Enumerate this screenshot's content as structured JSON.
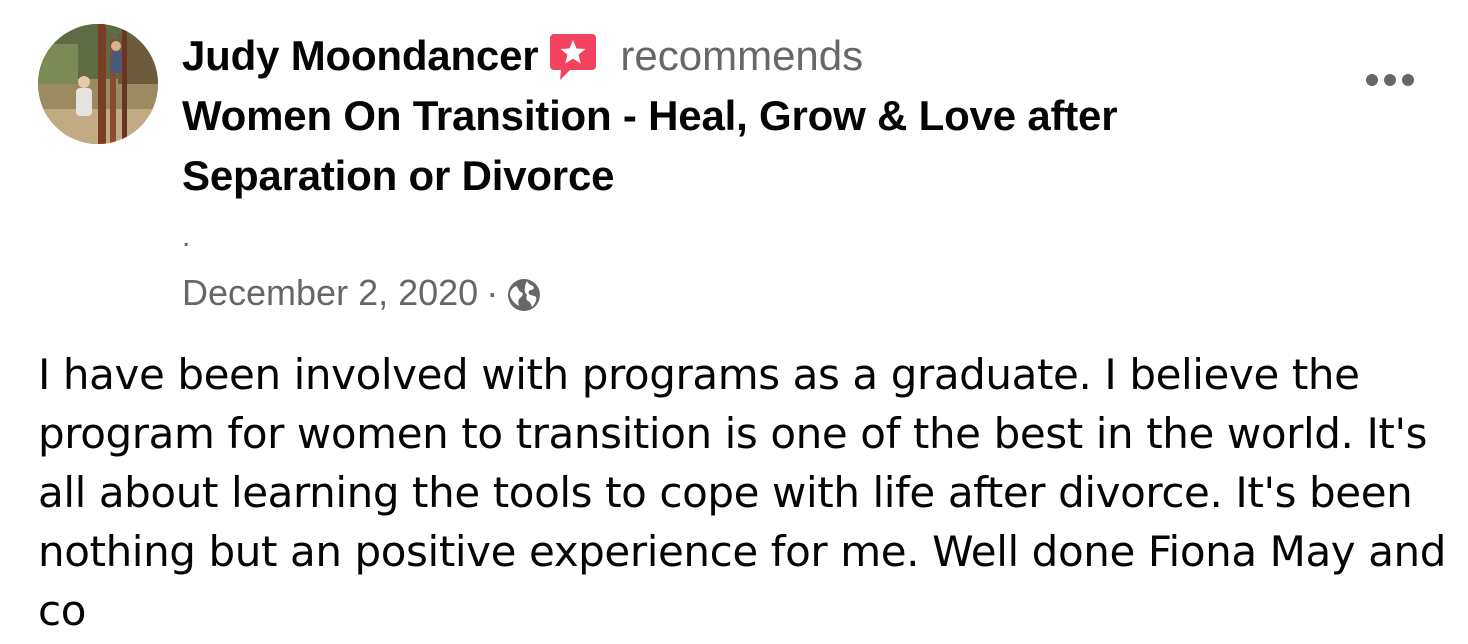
{
  "post": {
    "author": "Judy Moondancer",
    "action": "recommends",
    "page_title": "Women On Transition - Heal, Grow & Love after Separation or Divorce",
    "dot": ".",
    "date": "December 2, 2020",
    "separator": "·",
    "privacy_icon": "globe-icon",
    "recommend_icon": "star-speech-bubble-icon",
    "more_icon": "more-options-icon",
    "text": "I have been involved with programs as a graduate. I believe the program for women to transition is one of the best in the world. It's all about learning the tools to cope with life after divorce. It's been nothing but an positive experience for me. Well done Fiona May and co"
  },
  "colors": {
    "recommend_icon": "#f3425f",
    "secondary_text": "#65676b",
    "primary_text": "#050505"
  }
}
